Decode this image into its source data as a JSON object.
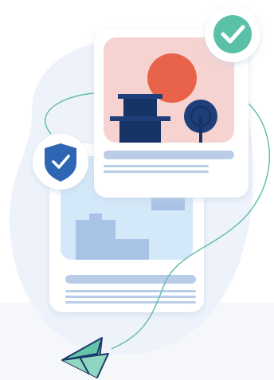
{
  "illustration": {
    "icons": {
      "check_badge": "check-circle-icon",
      "shield_badge": "shield-check-icon",
      "paper_plane": "paper-plane-icon",
      "sun": "sun-icon",
      "tree": "tree-icon",
      "building": "building-icon"
    },
    "colors": {
      "background_blob": "#eef3fb",
      "floor": "#f5f7fb",
      "card": "#ffffff",
      "card_shadow": "#dfe6f2",
      "front_image_bg": "#f6d3d1",
      "sun": "#e9634a",
      "navy": "#1f3f7a",
      "navy_dark": "#173466",
      "back_image_bg": "#d3e8f8",
      "back_shapes": "#a9c3e6",
      "text_lines": "#b9cde8",
      "check_green": "#5bc0a8",
      "shield_blue": "#2f66b3",
      "path_teal": "#5dbba8",
      "plane_teal": "#63c6a9",
      "plane_dark": "#1d3a6b"
    }
  }
}
